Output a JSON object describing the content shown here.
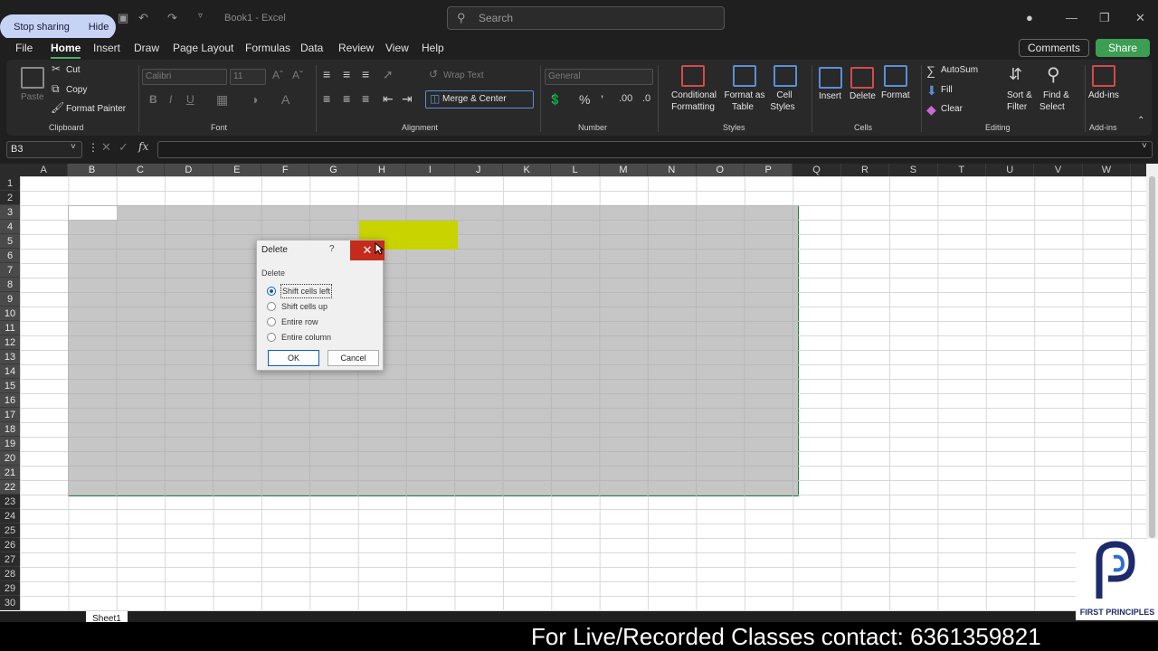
{
  "screen_share": {
    "stop_label": "Stop sharing",
    "hide_label": "Hide"
  },
  "title": {
    "doc": "Book1  -  Excel"
  },
  "search": {
    "placeholder": "Search"
  },
  "menu": {
    "tabs": [
      "File",
      "Home",
      "Insert",
      "Draw",
      "Page Layout",
      "Formulas",
      "Data",
      "Review",
      "View",
      "Help"
    ],
    "active": "Home",
    "comments_label": "Comments",
    "share_label": "Share"
  },
  "ribbon": {
    "clipboard": {
      "paste": "Paste",
      "cut": "Cut",
      "copy": "Copy",
      "format_painter": "Format Painter",
      "label": "Clipboard"
    },
    "font": {
      "name": "Calibri",
      "size": "11",
      "label": "Font"
    },
    "alignment": {
      "wrap": "Wrap Text",
      "merge": "Merge & Center",
      "label": "Alignment"
    },
    "number": {
      "format": "General",
      "label": "Number"
    },
    "styles": {
      "cond1": "Conditional",
      "cond2": "Formatting",
      "fat1": "Format as",
      "fat2": "Table",
      "cs1": "Cell",
      "cs2": "Styles",
      "label": "Styles"
    },
    "cells": {
      "insert": "Insert",
      "delete": "Delete",
      "format": "Format",
      "label": "Cells"
    },
    "editing": {
      "autosum": "AutoSum",
      "fill": "Fill",
      "clear": "Clear",
      "sort1": "Sort &",
      "sort2": "Filter",
      "find1": "Find &",
      "find2": "Select",
      "label": "Editing"
    },
    "addins": {
      "btn": "Add-ins",
      "label": "Add-ins"
    }
  },
  "formula_bar": {
    "name_box": "B3",
    "fx": "fx",
    "content": ""
  },
  "grid": {
    "columns": [
      "A",
      "B",
      "C",
      "D",
      "E",
      "F",
      "G",
      "H",
      "I",
      "J",
      "K",
      "L",
      "M",
      "N",
      "O",
      "P",
      "Q",
      "R",
      "S",
      "T",
      "U",
      "V",
      "W"
    ],
    "rows": [
      "1",
      "2",
      "3",
      "4",
      "5",
      "6",
      "7",
      "8",
      "9",
      "10",
      "11",
      "12",
      "13",
      "14",
      "15",
      "16",
      "17",
      "18",
      "19",
      "20",
      "21",
      "22",
      "23",
      "24",
      "25",
      "26",
      "27",
      "28",
      "29",
      "30"
    ],
    "selection": "B3:P22",
    "highlight_fill": "#c8d300"
  },
  "dialog": {
    "title": "Delete",
    "help": "?",
    "group": "Delete",
    "options": [
      "Shift cells left",
      "Shift cells up",
      "Entire row",
      "Entire column"
    ],
    "selected_index": 0,
    "ok": "OK",
    "cancel": "Cancel"
  },
  "sheet_tabs": [
    "Sheet1"
  ],
  "caption": "For Live/Recorded Classes contact: 6361359821",
  "logo": {
    "text": "FIRST PRINCIPLES",
    "icon": "fp-logo-icon"
  }
}
